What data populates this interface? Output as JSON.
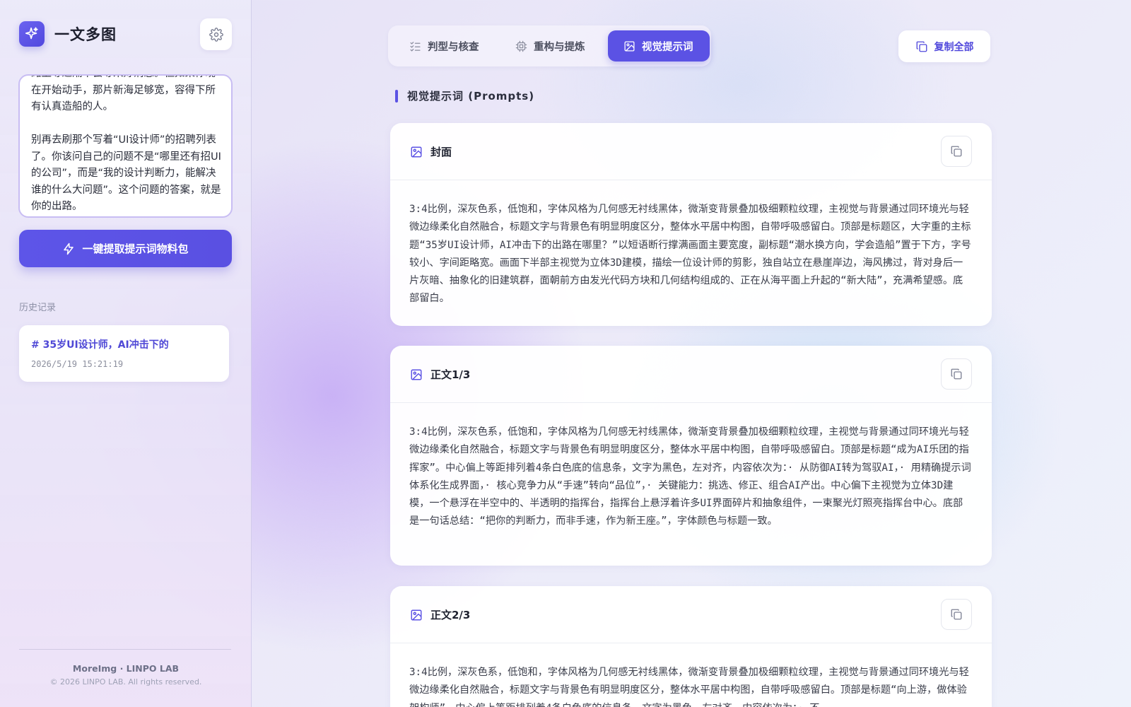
{
  "app": {
    "title": "一文多图",
    "icons": {
      "logo": "sparkle-icon",
      "settings": "gear-icon"
    }
  },
  "sidebar": {
    "source_text": "滩上等退潮不会等来好消息。但如果你现在开始动手，那片新海足够宽，容得下所有认真造船的人。\n\n别再去刷那个写着“UI设计师”的招聘列表了。你该问自己的问题不是“哪里还有招UI的公司”，而是“我的设计判断力，能解决谁的什么大问题”。这个问题的答案，就是你的出路。",
    "extract_button": "一键提取提示词物料包",
    "history_label": "历史记录",
    "history": [
      {
        "title": "# 35岁UI设计师，AI冲击下的",
        "date": "2026/5/19 15:21:19"
      }
    ],
    "footer_brand": "MoreImg · LINPO LAB",
    "footer_copy": "© 2026 LINPO LAB. All rights reserved."
  },
  "tabs": [
    {
      "label": "判型与核查",
      "icon": "checklist-icon",
      "active": false
    },
    {
      "label": "重构与提炼",
      "icon": "cpu-icon",
      "active": false
    },
    {
      "label": "视觉提示词",
      "icon": "image-icon",
      "active": true
    }
  ],
  "copy_all_label": "复制全部",
  "section_title": "视觉提示词 (Prompts)",
  "cards": [
    {
      "title": "封面",
      "body": "3:4比例，深灰色系，低饱和，字体风格为几何感无衬线黑体，微渐变背景叠加极细颗粒纹理，主视觉与背景通过同环境光与轻微边缘柔化自然融合，标题文字与背景色有明显明度区分，整体水平居中构图，自带呼吸感留白。顶部是标题区，大字重的主标题“35岁UI设计师，AI冲击下的出路在哪里？”以短语断行撑满画面主要宽度，副标题“潮水换方向，学会造船”置于下方，字号较小、字间距略宽。画面下半部主视觉为立体3D建模，描绘一位设计师的剪影，独自站立在悬崖岸边，海风拂过，背对身后一片灰暗、抽象化的旧建筑群，面朝前方由发光代码方块和几何结构组成的、正在从海平面上升起的“新大陆”，充满希望感。底部留白。"
    },
    {
      "title": "正文1/3",
      "body": "3:4比例，深灰色系，低饱和，字体风格为几何感无衬线黑体，微渐变背景叠加极细颗粒纹理，主视觉与背景通过同环境光与轻微边缘柔化自然融合，标题文字与背景色有明显明度区分，整体水平居中构图，自带呼吸感留白。顶部是标题“成为AI乐团的指挥家”。中心偏上等距排列着4条白色底的信息条，文字为黑色，左对齐，内容依次为：· 从防御AI转为驾驭AI，· 用精确提示词体系化生成界面，· 核心竞争力从“手速”转向“品位”，· 关键能力：挑选、修正、组合AI产出。中心偏下主视觉为立体3D建模，一个悬浮在半空中的、半透明的指挥台，指挥台上悬浮着许多UI界面碎片和抽象组件，一束聚光灯照亮指挥台中心。底部是一句话总结：“把你的判断力，而非手速，作为新王座。”，字体颜色与标题一致。"
    },
    {
      "title": "正文2/3",
      "body": "3:4比例，深灰色系，低饱和，字体风格为几何感无衬线黑体，微渐变背景叠加极细颗粒纹理，主视觉与背景通过同环境光与轻微边缘柔化自然融合，标题文字与背景色有明显明度区分，整体水平居中构图，自带呼吸感留白。顶部是标题“向上游，做体验架构师”。中心偏上等距排列着4条白色底的信息条，文字为黑色，左对齐，内容依次为：· 不"
    }
  ],
  "colors": {
    "accent": "#5b52e4",
    "accent_text": "#5149dc"
  }
}
